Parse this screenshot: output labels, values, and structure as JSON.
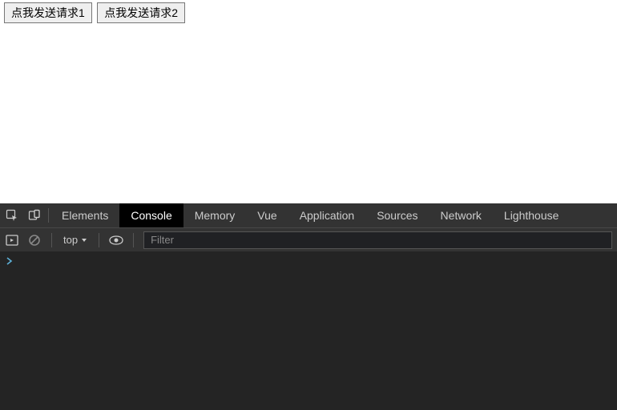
{
  "page": {
    "buttons": [
      "点我发送请求1",
      "点我发送请求2"
    ]
  },
  "devtools": {
    "tabs": [
      "Elements",
      "Console",
      "Memory",
      "Vue",
      "Application",
      "Sources",
      "Network",
      "Lighthouse"
    ],
    "active_tab": "Console",
    "toolbar": {
      "context": "top",
      "filter_placeholder": "Filter"
    },
    "prompt": ">"
  }
}
